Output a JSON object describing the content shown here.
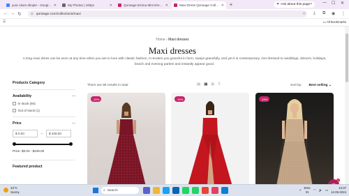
{
  "browser": {
    "tabs": [
      {
        "title": "your eisen dimple - Google S...",
        "fav": "#4285f4",
        "active": false
      },
      {
        "title": "My Photos | 100px",
        "fav": "#666666",
        "active": false
      },
      {
        "title": "Qonsage Emma Mini Dress Ar...",
        "fav": "#c8236b",
        "active": false
      },
      {
        "title": "Maxi Dress Qonsage Collection",
        "fav": "#c8236b",
        "active": true
      }
    ],
    "ask": "Ask about this page?",
    "url": "qonsage.com/collections/maxi",
    "all_bookmarks": "All Bookmarks"
  },
  "page": {
    "breadcrumb_home": "Home",
    "breadcrumb_sep": "›",
    "breadcrumb_current": "Maxi dresses",
    "title": "Maxi dresses",
    "description": "A long maxi dress can be worn at any time when you are in love with classic fashion. It renders you graceful in form, sways gracefully, and yet it is contemporary. Get dressed to weddings, dinners, holidays, beach and evening parties and instantly appear good."
  },
  "filters": {
    "heading": "Products Category",
    "availability": {
      "label": "Availability",
      "options": [
        "In stock (94)",
        "Out of stock (1)"
      ]
    },
    "price": {
      "label": "Price",
      "min": "$ 0.00",
      "max": "$ 228.00",
      "summary": "Price: $0.00 - $228.00"
    },
    "featured": {
      "label": "Featured product"
    }
  },
  "toolbar": {
    "results": "There are 95 results in total",
    "sort_label": "Sort by:",
    "sort_value": "Best selling"
  },
  "products": [
    {
      "badge": "-20%",
      "color": "#7a1526"
    },
    {
      "badge": "-16%",
      "color": "#c4161f"
    },
    {
      "badge": "-19%",
      "color": "#b89a7e"
    }
  ],
  "taskbar": {
    "temp": "34°C",
    "condition": "Sunny",
    "search": "Search",
    "lang": "ENG",
    "region": "IN",
    "time": "13:37",
    "date": "14-05-2024"
  },
  "colors": {
    "accent": "#c8236b",
    "tabbar": "#f3e8f7"
  }
}
